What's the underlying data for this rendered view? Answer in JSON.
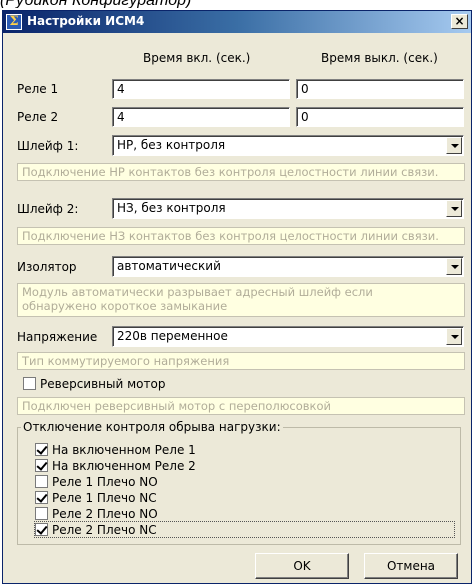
{
  "caption": "(Рубикон Конфигуратор)",
  "window": {
    "title": "Настройки ИСМ4",
    "close_glyph": "×"
  },
  "columns": {
    "on_time": "Время вкл. (сек.)",
    "off_time": "Время выкл. (сек.)"
  },
  "relays": [
    {
      "label": "Реле 1",
      "on": "4",
      "off": "0"
    },
    {
      "label": "Реле 2",
      "on": "4",
      "off": "0"
    }
  ],
  "loop1": {
    "label": "Шлейф 1:",
    "value": "НР, без контроля",
    "hint": "Подключение НР контактов без контроля целостности линии связи."
  },
  "loop2": {
    "label": "Шлейф 2:",
    "value": "НЗ, без контроля",
    "hint": "Подключение НЗ контактов без контроля целостности линии связи."
  },
  "isolator": {
    "label": "Изолятор",
    "value": "автоматический",
    "hint_line1": "Модуль автоматически разрывает адресный шлейф если",
    "hint_line2": "обнаружено короткое замыкание"
  },
  "voltage": {
    "label": "Напряжение",
    "value": "220в переменное",
    "hint": "Тип коммутируемого напряжения"
  },
  "reverse_motor": {
    "label": "Реверсивный мотор",
    "checked": false,
    "hint": "Подключен реверсивный мотор с переполюсовкой"
  },
  "load_break": {
    "title": "Отключение контроля обрыва нагрузки:",
    "items": [
      {
        "label": "На включенном Реле 1",
        "checked": true
      },
      {
        "label": "На включенном Реле 2",
        "checked": true
      },
      {
        "label": "Реле 1 Плечо NO",
        "checked": false
      },
      {
        "label": "Реле 1 Плечо NC",
        "checked": true
      },
      {
        "label": "Реле 2 Плечо NO",
        "checked": false
      },
      {
        "label": "Реле 2 Плечо NC",
        "checked": true
      }
    ]
  },
  "buttons": {
    "ok": "OK",
    "cancel": "Отмена"
  },
  "icons": {
    "app": "sigma-app-icon",
    "close": "close-icon",
    "dropdown": "chevron-down-icon",
    "checkbox": "checkbox-icon"
  }
}
